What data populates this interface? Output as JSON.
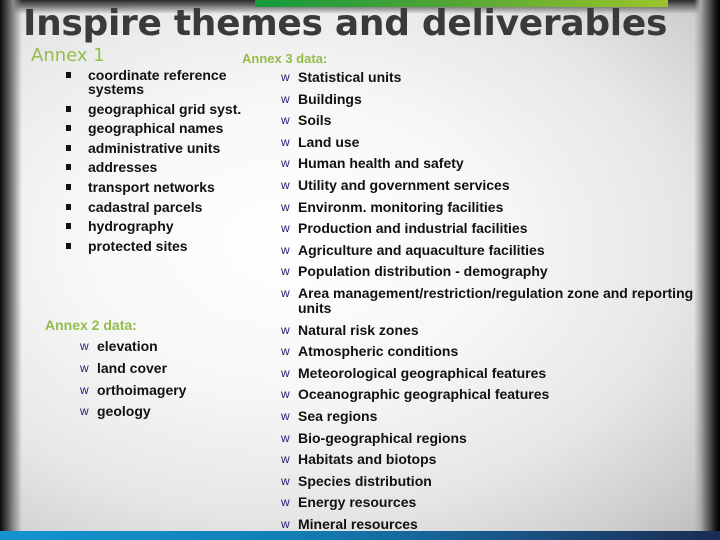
{
  "title": "Inspire themes and deliverables",
  "annex1": {
    "heading": "Annex 1",
    "items": [
      "coordinate reference systems",
      "geographical grid syst.",
      "geographical names",
      "administrative units",
      "addresses",
      "transport networks",
      "cadastral parcels",
      "hydrography",
      "protected sites"
    ],
    "bullet_icon": "square-bullet"
  },
  "annex2": {
    "heading": "Annex 2 data:",
    "items": [
      "elevation",
      "land cover",
      "orthoimagery",
      "geology"
    ]
  },
  "annex3": {
    "heading": "Annex 3 data:",
    "items": [
      "Statistical units",
      "Buildings",
      "Soils",
      "Land use",
      "Human health and safety",
      "Utility and government services",
      "Environm. monitoring facilities",
      "Production and industrial facilities",
      "Agriculture and aquaculture facilities",
      "Population distribution - demography",
      "Area management/restriction/regulation zone and reporting units",
      "Natural risk zones",
      "Atmospheric conditions",
      "Meteorological geographical features",
      "Oceanographic geographical features",
      "Sea regions",
      "Bio-geographical regions",
      "Habitats and biotops",
      "Species distribution",
      "Energy resources",
      "Mineral resources"
    ]
  },
  "bullets": {
    "w_glyph": "w"
  },
  "colors": {
    "heading_green": "#94bc4a",
    "title_gray": "#3a3a3a",
    "bullet_navy": "#1f1f6e",
    "top_bar_start": "#149a3c",
    "top_bar_end": "#9cc52a",
    "bottom_bar_start": "#1593d0",
    "bottom_bar_end": "#1b2c52"
  }
}
